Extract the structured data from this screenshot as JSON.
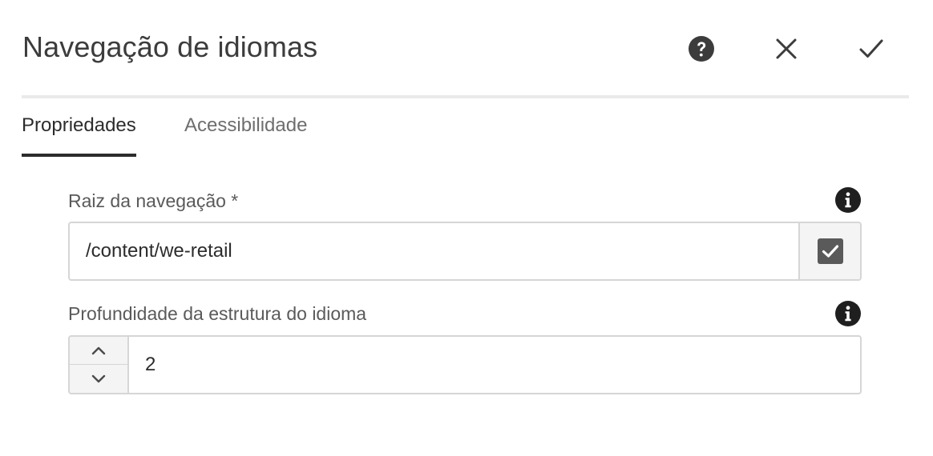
{
  "dialog": {
    "title": "Navegação de idiomas",
    "actions": {
      "help_icon": "help-circle-icon",
      "close_icon": "close-icon",
      "done_icon": "checkmark-icon"
    }
  },
  "tabs": [
    {
      "label": "Propriedades",
      "selected": true
    },
    {
      "label": "Acessibilidade",
      "selected": false
    }
  ],
  "fields": {
    "navigation_root": {
      "label": "Raiz da navegação *",
      "value": "/content/we-retail",
      "info_icon": "info-icon",
      "picker_icon": "checkbox-check-icon"
    },
    "language_depth": {
      "label": "Profundidade da estrutura do idioma",
      "value": "2",
      "info_icon": "info-icon"
    }
  },
  "colors": {
    "text": "#323232",
    "icon_dark": "#2c2c2c",
    "border": "#d6d6d6",
    "tab_indicator": "#2c2c2c"
  }
}
